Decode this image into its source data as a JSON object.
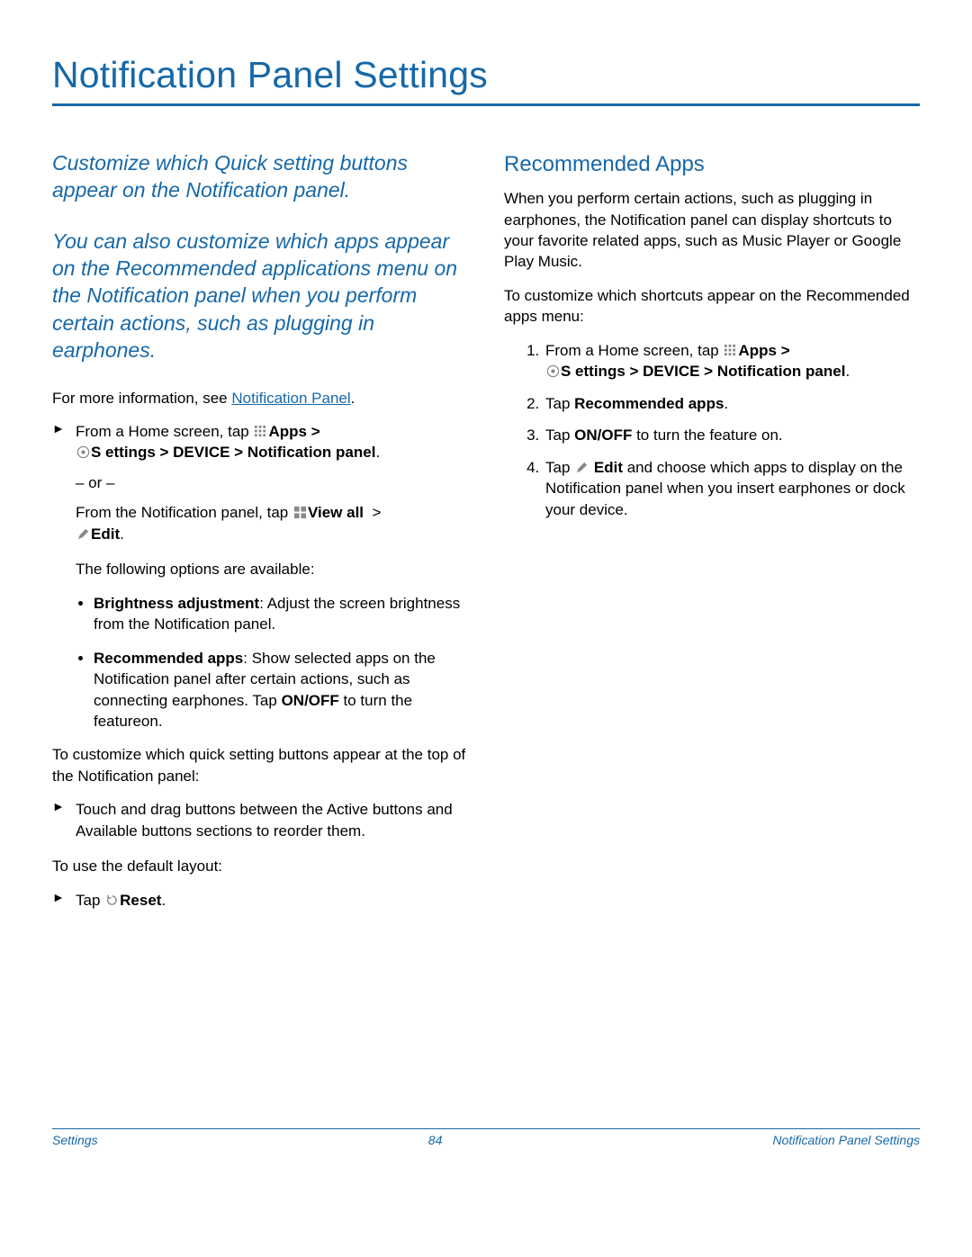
{
  "title": "Notification Panel Settings",
  "left": {
    "intro1": "Customize which Quick setting buttons appear on the Notification panel.",
    "intro2": "You can also customize which apps appear on the Recommended applications menu on the Notification panel when you perform certain actions, such as plugging in earphones.",
    "moreInfo_pre": "For more information, see ",
    "moreInfo_link": "Notification Panel",
    "moreInfo_post": ".",
    "step_home_pre": "From a Home screen, tap ",
    "apps_label": "Apps",
    "gt": " > ",
    "settings_path": "S ettings > DEVICE > Notification panel",
    "or": "– or –",
    "from_np_pre": "From the Notification panel, tap ",
    "view_all": "View all",
    "edit": "Edit",
    "period": ".",
    "options_lead": "The following options are available:",
    "bullet1_strong": "Brightness adjustment",
    "bullet1_rest": ": Adjust the screen brightness from the Notification panel.",
    "bullet2_strong": "Recommended apps",
    "bullet2_rest_a": ": Show selected apps on the Notification panel after certain actions, such as connecting earphones. Tap ",
    "bullet2_onoff": "ON/OFF",
    "bullet2_rest_b": " to turn the featureon.",
    "customize_lead": "To customize which quick setting buttons appear at the top of the Notification panel:",
    "drag_step": "Touch and drag buttons between the Active buttons and Available buttons sections to reorder them.",
    "default_lead": "To use the default layout:",
    "tap_reset_pre": "Tap ",
    "reset": "Reset"
  },
  "right": {
    "heading": "Recommended Apps",
    "para1": "When you perform certain actions, such as plugging in earphones, the Notification panel can display shortcuts to your favorite related apps, such as Music Player or Google Play Music.",
    "para2": "To customize which shortcuts appear on the Recommended apps menu:",
    "s1_pre": "From a Home screen, tap ",
    "apps_label": "Apps",
    "gt": " > ",
    "settings_path": "S ettings > DEVICE > Notification panel",
    "period": ".",
    "s2_pre": "Tap ",
    "s2_strong": "Recommended apps",
    "s3_pre": "Tap ",
    "s3_strong": "ON/OFF",
    "s3_post": " to turn the feature on.",
    "s4_pre": "Tap ",
    "s4_edit": "Edit",
    "s4_post": " and choose which apps to display on the Notification panel when you insert earphones or dock your device."
  },
  "footer": {
    "left": "Settings",
    "center": "84",
    "right": "Notification Panel Settings"
  }
}
